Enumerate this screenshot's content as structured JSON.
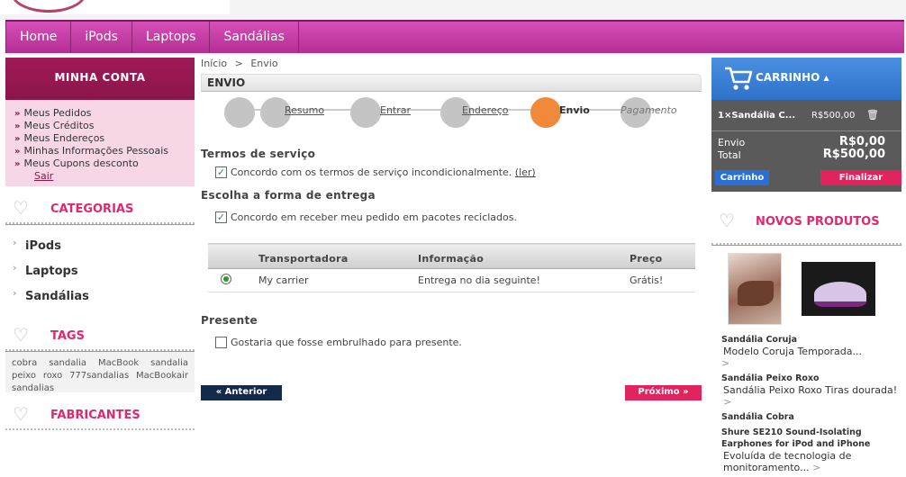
{
  "nav": {
    "items": [
      "Home",
      "iPods",
      "Laptops",
      "Sandálias"
    ]
  },
  "account": {
    "title": "MINHA CONTA",
    "links": [
      "Meus Pedidos",
      "Meus Créditos",
      "Meus Endereços",
      "Minhas Informações Pessoais",
      "Meus Cupons desconto"
    ],
    "logout": "Sair"
  },
  "categories": {
    "title": "CATEGORIAS",
    "items": [
      "iPods",
      "Laptops",
      "Sandálias"
    ]
  },
  "tags": {
    "title": "TAGS",
    "text": "cobra sandalia MacBook sandalia peixo roxo 777sandalias MacBookair sandalias"
  },
  "manufacturers": {
    "title": "FABRICANTES"
  },
  "breadcrumb": {
    "home": "Início",
    "sep": ">",
    "current": "Envio"
  },
  "page": {
    "title": "ENVIO"
  },
  "steps": [
    "Resumo",
    "Entrar",
    "Endereço",
    "Envio",
    "Pagamento"
  ],
  "terms": {
    "title": "Termos de serviço",
    "label": "Concordo com os termos de serviço incondicionalmente.",
    "link": "(ler)"
  },
  "delivery": {
    "title": "Escolha a forma de entrega",
    "recycled_label": "Concordo em receber meu pedido em pacotes reciclados."
  },
  "carrier_table": {
    "headers": [
      "Transportadora",
      "Informação",
      "Preço"
    ],
    "rows": [
      {
        "carrier": "My carrier",
        "info": "Entrega no dia seguinte!",
        "price": "Grátis!"
      }
    ]
  },
  "gift": {
    "title": "Presente",
    "label": "Gostaria que fosse embrulhado para presente."
  },
  "buttons": {
    "prev": "« Anterior",
    "next": "Próximo »"
  },
  "cart": {
    "title": "CARRINHO",
    "item_qty": "1×",
    "item_name": "Sandália C...",
    "item_price": "R$500,00",
    "shipping_label": "Envio",
    "shipping_value": "R$0,00",
    "total_label": "Total",
    "total_value": "R$500,00",
    "cart_button": "Carrinho",
    "checkout_button": "Finalizar"
  },
  "new_products": {
    "title": "NOVOS PRODUTOS",
    "items": [
      {
        "name": "Sandália Coruja",
        "desc": "Modelo Coruja Temporada..."
      },
      {
        "name": "Sandália Peixo Roxo",
        "desc": "Sandália Peixo Roxo Tiras dourada!"
      },
      {
        "name": "Sandália Cobra",
        "desc": ""
      },
      {
        "name": "Shure SE210 Sound-Isolating Earphones for iPod and iPhone",
        "desc": "Evoluída de tecnologia de monitoramento..."
      }
    ]
  },
  "colors": {
    "nav": "#c13fa4",
    "account_head": "#8c154a",
    "accent_pink": "#e0286e",
    "cart_blue": "#3a80d6",
    "active_step": "#f08a3a"
  }
}
